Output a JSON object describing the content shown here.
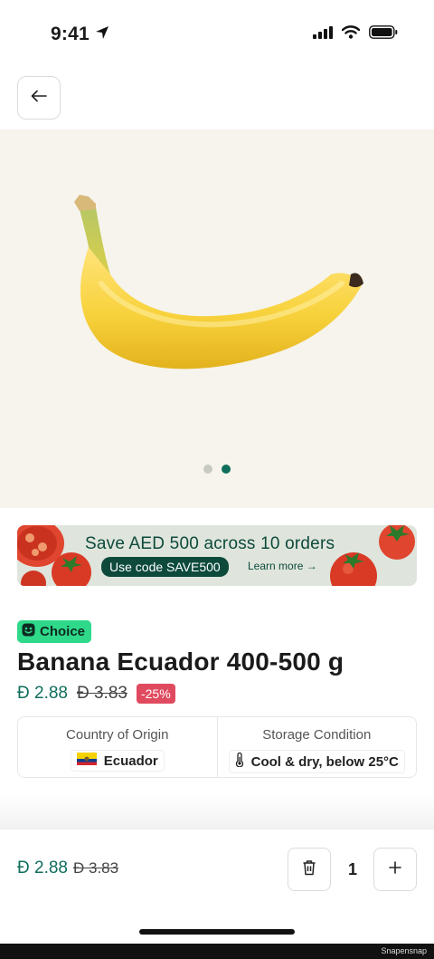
{
  "status_bar": {
    "time": "9:41",
    "icons": [
      "location-arrow-icon",
      "cellular-signal-icon",
      "wifi-icon",
      "battery-icon"
    ]
  },
  "nav": {
    "back_icon": "arrow-left-icon"
  },
  "gallery": {
    "image": "banana",
    "slides_count": 2,
    "active_slide": 2
  },
  "promo": {
    "title": "Save AED 500 across 10 orders",
    "code_text": "Use code SAVE500",
    "link_text": "Learn more →",
    "colors": {
      "background": "#dfe5dc",
      "text": "#0d4a3c"
    }
  },
  "product": {
    "badge_icon": "smiley-icon",
    "badge": "Choice",
    "title": "Banana Ecuador 400-500 g",
    "currency_symbol": "Đ",
    "price": "Đ 2.88",
    "original_price": "Đ 3.83",
    "discount": "-25%"
  },
  "attributes": [
    {
      "label": "Country of Origin",
      "value": "Ecuador",
      "icon": "ecuador-flag-icon"
    },
    {
      "label": "Storage Condition",
      "value": "Cool & dry, below 25°C",
      "icon": "thermometer-icon"
    }
  ],
  "cart": {
    "price": "Đ 2.88",
    "original_price": "Đ 3.83",
    "quantity": "1",
    "delete_icon": "trash-icon",
    "add_icon": "plus-icon"
  },
  "watermark": "Snapensnap",
  "colors": {
    "accent": "#0f6e5c",
    "badge_green": "#2fd98a",
    "discount_red": "#e04a5f"
  }
}
